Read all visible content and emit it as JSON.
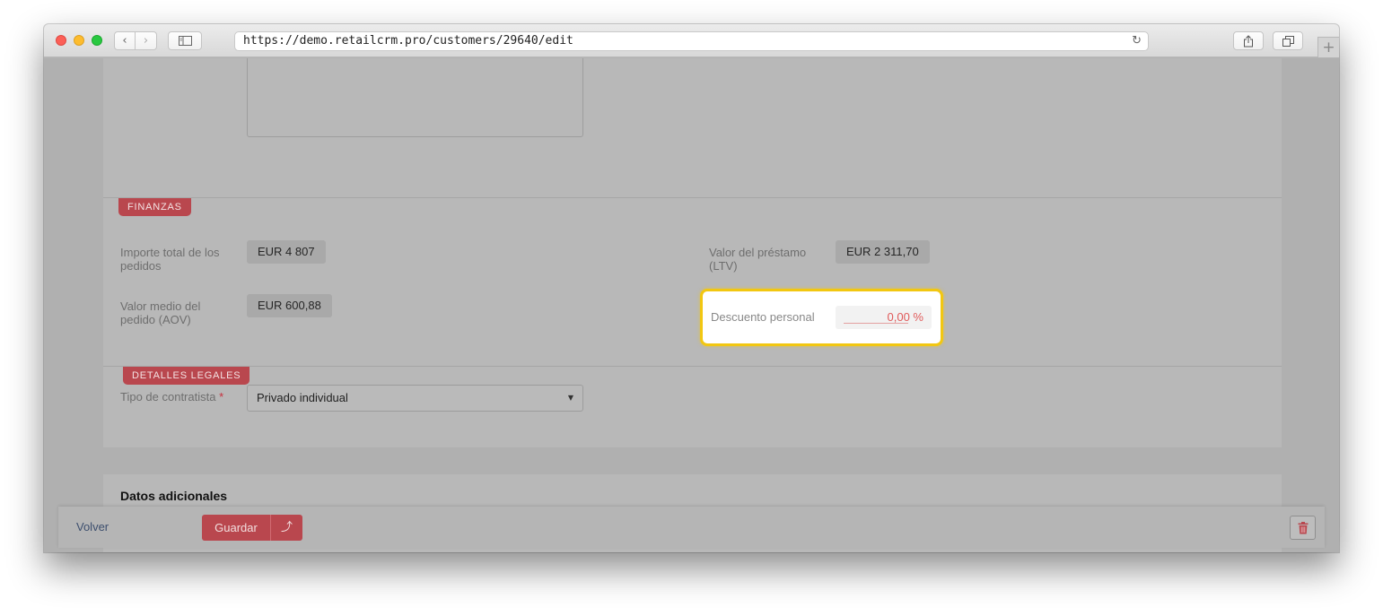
{
  "browser": {
    "url": "https://demo.retailcrm.pro/customers/29640/edit",
    "back_glyph": "‹",
    "forward_glyph": "›",
    "reload_glyph": "↻",
    "new_tab_glyph": "+"
  },
  "finance": {
    "section_tag": "FINANZAS",
    "total_label": "Importe total de los pedidos",
    "total_value": "EUR 4 807",
    "aov_label": "Valor medio del pedido (AOV)",
    "aov_value": "EUR 600,88",
    "ltv_label": "Valor del préstamo (LTV)",
    "ltv_value": "EUR 2 311,70",
    "discount_label": "Descuento personal",
    "discount_value": "0,00 %"
  },
  "legal": {
    "section_tag": "DETALLES LEGALES",
    "contractor_label": "Tipo de contratista",
    "required_mark": "*",
    "contractor_value": "Privado individual",
    "caret_glyph": "▼"
  },
  "additional": {
    "title": "Datos adicionales"
  },
  "footer": {
    "back_label": "Volver",
    "save_label": "Guardar",
    "save_up_glyph": "⤴"
  },
  "colors": {
    "accent": "#b9474e",
    "highlight": "#f2c711",
    "discount_text": "#e05a5a"
  },
  "icons": {
    "back": "chevron-left-icon",
    "forward": "chevron-right-icon",
    "sidebar": "sidebar-icon",
    "reload": "reload-icon",
    "share": "share-icon",
    "tabs": "tabs-icon",
    "trash": "trash-icon"
  }
}
